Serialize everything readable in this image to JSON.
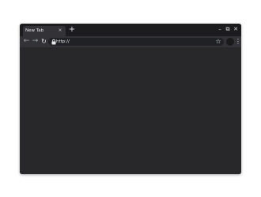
{
  "tabs": [
    {
      "title": "New Tab",
      "close_glyph": "×"
    }
  ],
  "new_tab": {
    "glyph": "+"
  },
  "window_controls": {
    "minimize": "–",
    "maximize": "⧉",
    "close": "✕"
  },
  "toolbar": {
    "back": "←",
    "forward": "→",
    "reload": "↻",
    "url": "http://",
    "bookmark": "☆",
    "menu": "⋮"
  },
  "colors": {
    "titlebar": "#1c1c1e",
    "tab_active": "#323237",
    "toolbar": "#323237",
    "omnibox": "#202124",
    "content": "#28282a",
    "text": "#e8eaed"
  }
}
